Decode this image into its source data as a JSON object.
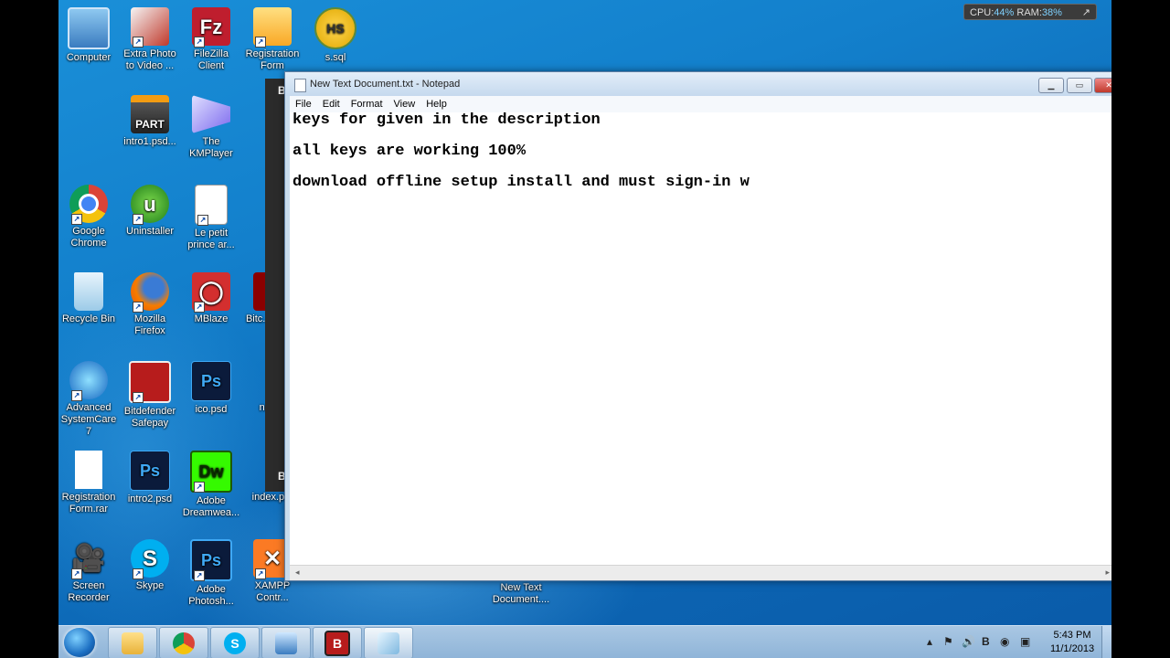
{
  "gadget": {
    "cpu_label": "CPU:",
    "cpu_value": "44%",
    "ram_label": "RAM:",
    "ram_value": "38%"
  },
  "desktop_icons": [
    {
      "label": "Computer"
    },
    {
      "label": "Extra Photo to Video ..."
    },
    {
      "label": "FileZilla Client"
    },
    {
      "label": "Registration Form"
    },
    {
      "label": "s.sql",
      "glyph": "HS"
    },
    {
      "label": "intro1.psd...",
      "glyph": "PART"
    },
    {
      "label": "The KMPlayer"
    },
    {
      "label": "Google Chrome"
    },
    {
      "label": "Uninstaller"
    },
    {
      "label": "Le petit prince ar..."
    },
    {
      "label": "Recycle Bin"
    },
    {
      "label": "Mozilla Firefox"
    },
    {
      "label": "MBlaze"
    },
    {
      "label": "Bitc... Anti..."
    },
    {
      "label": "Advanced SystemCare 7"
    },
    {
      "label": "Bitdefender Safepay"
    },
    {
      "label": "ico.psd",
      "glyph": "Ps"
    },
    {
      "label": "new..."
    },
    {
      "label": "Registration Form.rar"
    },
    {
      "label": "intro2.psd",
      "glyph": "Ps"
    },
    {
      "label": "Adobe Dreamwea...",
      "glyph": "Dw"
    },
    {
      "label": "index.p..."
    },
    {
      "label": "Screen Recorder"
    },
    {
      "label": "Skype",
      "glyph": "S"
    },
    {
      "label": "Adobe Photosh...",
      "glyph": "Ps"
    },
    {
      "label": "XAMPP Contr..."
    },
    {
      "label": "New Text Document...."
    }
  ],
  "bg_window_glyph": "B",
  "notepad": {
    "title": "New Text Document.txt - Notepad",
    "menu": [
      "File",
      "Edit",
      "Format",
      "View",
      "Help"
    ],
    "lines": [
      "keys for given in the description",
      "all keys are working 100%",
      "download offline setup install and must sign-in w"
    ]
  },
  "taskbar": {
    "tray_glyph": "B",
    "time": "5:43 PM",
    "date": "11/1/2013"
  },
  "colors": {
    "desktop": "#1380cc",
    "taskbar": "#9dbfe0",
    "notepad_frame": "#c9dced"
  }
}
